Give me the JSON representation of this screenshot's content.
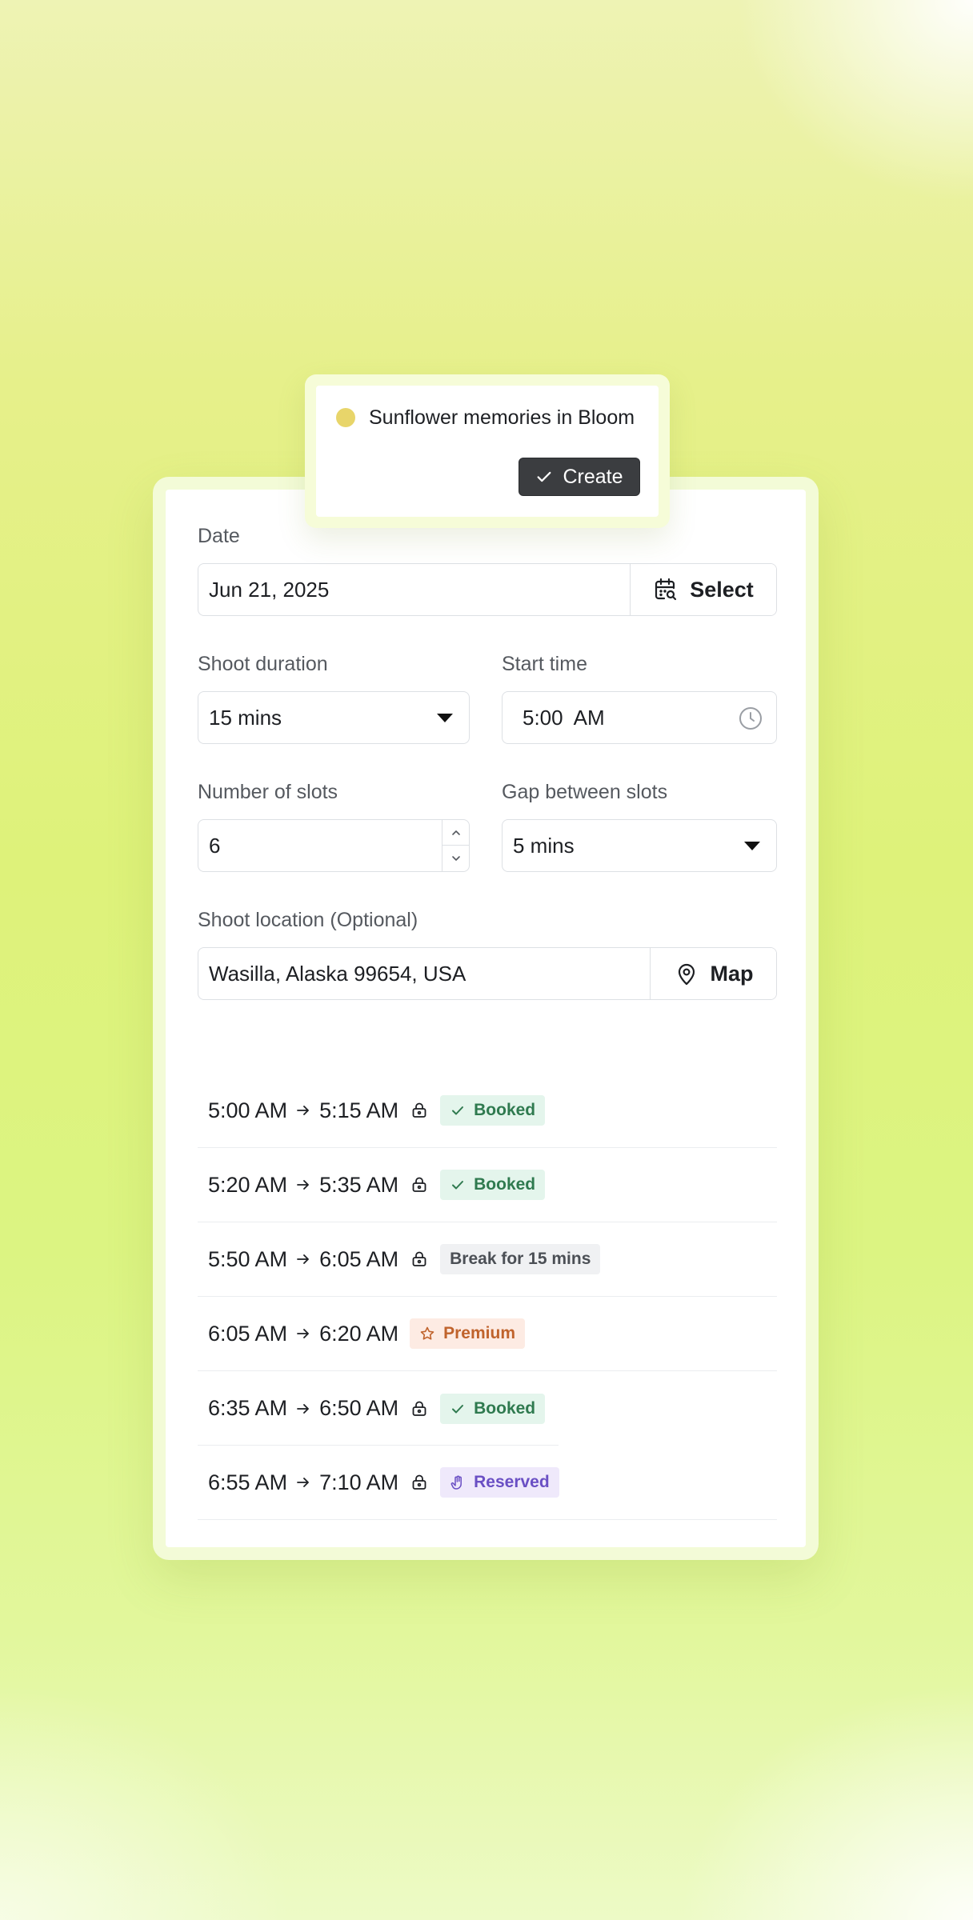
{
  "popover": {
    "title": "Sunflower memories in Bloom",
    "create_label": "Create",
    "dot_color": "#e8d56a"
  },
  "form": {
    "date": {
      "label": "Date",
      "value": "Jun 21, 2025",
      "button_label": "Select"
    },
    "shoot_duration": {
      "label": "Shoot duration",
      "value": "15 mins"
    },
    "start_time": {
      "label": "Start time",
      "value": "5:00  AM"
    },
    "number_of_slots": {
      "label": "Number of slots",
      "value": "6"
    },
    "gap_between_slots": {
      "label": "Gap between slots",
      "value": "5 mins"
    },
    "shoot_location": {
      "label": "Shoot location (Optional)",
      "value": "Wasilla, Alaska 99654, USA",
      "button_label": "Map"
    }
  },
  "slots": [
    {
      "start": "5:00 AM",
      "end": "5:15 AM",
      "status": "Booked",
      "status_type": "booked"
    },
    {
      "start": "5:20 AM",
      "end": "5:35 AM",
      "status": "Booked",
      "status_type": "booked"
    },
    {
      "start": "5:50 AM",
      "end": "6:05 AM",
      "status": "Break for 15 mins",
      "status_type": "break"
    },
    {
      "start": "6:05 AM",
      "end": "6:20 AM",
      "status": "Premium",
      "status_type": "premium"
    },
    {
      "start": "6:35 AM",
      "end": "6:50 AM",
      "status": "Booked",
      "status_type": "booked"
    },
    {
      "start": "6:55 AM",
      "end": "7:10 AM",
      "status": "Reserved",
      "status_type": "reserved"
    }
  ],
  "colors": {
    "booked": "#2f7a4f",
    "premium": "#c0632c",
    "reserved": "#6a4fc4",
    "create_button": "#3b3d40"
  }
}
